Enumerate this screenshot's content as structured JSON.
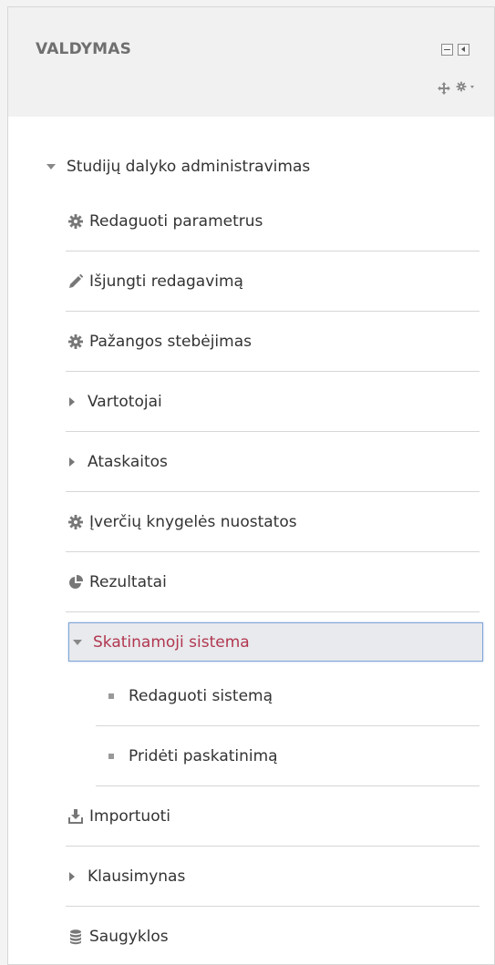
{
  "block": {
    "title": "VALDYMAS",
    "controls": {
      "hide_icon": "minus-square-icon",
      "dock_icon": "dock-arrow-icon",
      "move_icon": "move-arrows-icon",
      "actions_icon": "gear-menu-icon"
    }
  },
  "tree": {
    "course_label": "Studijų dalyko administravimas",
    "items": [
      {
        "label": "Redaguoti parametrus",
        "icon": "gear-icon"
      },
      {
        "label": "Išjungti redagavimą",
        "icon": "pencil-icon"
      },
      {
        "label": "Pažangos stebėjimas",
        "icon": "gear-icon"
      },
      {
        "label": "Vartotojai",
        "icon": "expand-arrow-icon"
      },
      {
        "label": "Ataskaitos",
        "icon": "expand-arrow-icon"
      },
      {
        "label": "Įverčių knygelės nuostatos",
        "icon": "gear-icon"
      },
      {
        "label": "Rezultatai",
        "icon": "outcomes-pie-icon"
      },
      {
        "label": "Skatinamoji sistema",
        "icon": "collapse-arrow-icon",
        "active": true
      },
      {
        "label": "Importuoti",
        "icon": "import-icon"
      },
      {
        "label": "Klausimynas",
        "icon": "expand-arrow-icon"
      },
      {
        "label": "Saugyklos",
        "icon": "database-icon"
      }
    ],
    "subitems": [
      {
        "label": "Redaguoti sistemą"
      },
      {
        "label": "Pridėti paskatinimą"
      }
    ]
  },
  "colors": {
    "active_text": "#b23650",
    "active_border": "#7fa6d8",
    "header_bg": "#f1f1f1"
  }
}
